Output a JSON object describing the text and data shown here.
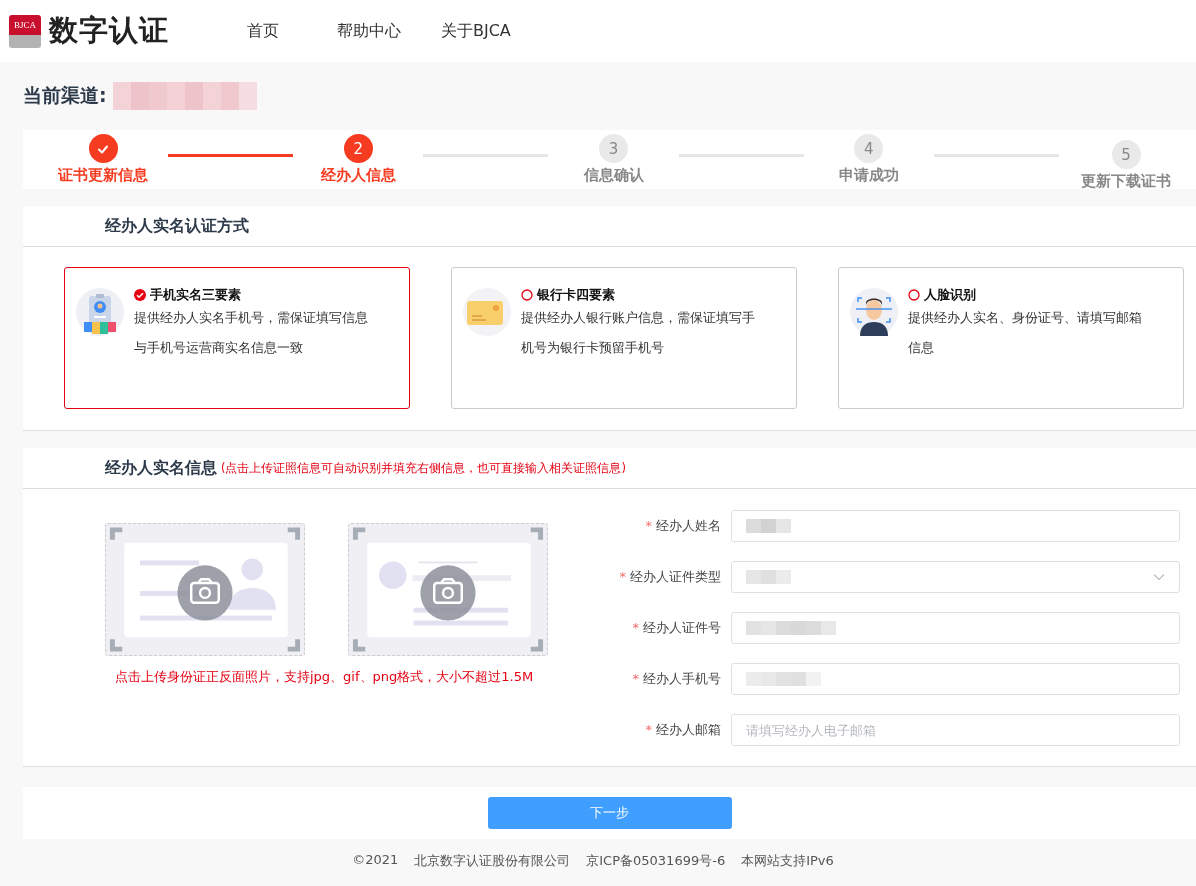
{
  "header": {
    "logo_badge": "BJCA",
    "logo_text": "数字认证",
    "nav": [
      {
        "label": "首页",
        "selected": false
      },
      {
        "label": "帮助中心",
        "selected": false
      },
      {
        "label": "关于BJCA",
        "selected": false
      }
    ]
  },
  "channel": {
    "label": "当前渠道:",
    "redacted": true
  },
  "steps": [
    {
      "kind": "done",
      "label": "证书更新信息"
    },
    {
      "kind": "current",
      "number": "2",
      "label": "经办人信息"
    },
    {
      "kind": "pending",
      "number": "3",
      "label": "信息确认"
    },
    {
      "kind": "pending",
      "number": "4",
      "label": "申请成功"
    },
    {
      "kind": "pending",
      "number": "5",
      "label": "更新下载证书"
    }
  ],
  "auth_section": {
    "title": "经办人实名认证方式",
    "methods": [
      {
        "kind": "phone",
        "title": "手机实名三要素",
        "description": "提供经办人实名手机号，需保证填写信息与手机号运营商实名信息一致",
        "selected": true
      },
      {
        "kind": "bank",
        "title": "银行卡四要素",
        "description": "提供经办人银行账户信息，需保证填写手机号为银行卡预留手机号",
        "selected": false
      },
      {
        "kind": "face",
        "title": "人脸识别",
        "description": "提供经办人实名、身份证号、请填写邮箱信息",
        "selected": false
      }
    ]
  },
  "info_section": {
    "title": "经办人实名信息",
    "hint": "(点击上传证照信息可自动识别并填充右侧信息，也可直接输入相关证照信息)",
    "uploads": [
      {
        "kind": "front"
      },
      {
        "kind": "back"
      }
    ],
    "upload_note": "点击上传身份证正反面照片，支持jpg、gif、png格式，大小不超过1.5M",
    "fields": [
      {
        "required_mark": "*",
        "label": "经办人姓名",
        "kind": "text",
        "redacted": true
      },
      {
        "required_mark": "*",
        "label": "经办人证件类型",
        "kind": "select",
        "redacted": true
      },
      {
        "required_mark": "*",
        "label": "经办人证件号",
        "kind": "text",
        "redacted": true
      },
      {
        "required_mark": "*",
        "label": "经办人手机号",
        "kind": "text",
        "redacted": true
      },
      {
        "required_mark": "*",
        "label": "经办人邮箱",
        "kind": "text",
        "placeholder": "请填写经办人电子邮箱"
      }
    ]
  },
  "next_button": "下一步",
  "footer": [
    "©2021",
    "北京数字认证股份有限公司",
    "京ICP备05031699号-6",
    "本网站支持IPv6"
  ]
}
